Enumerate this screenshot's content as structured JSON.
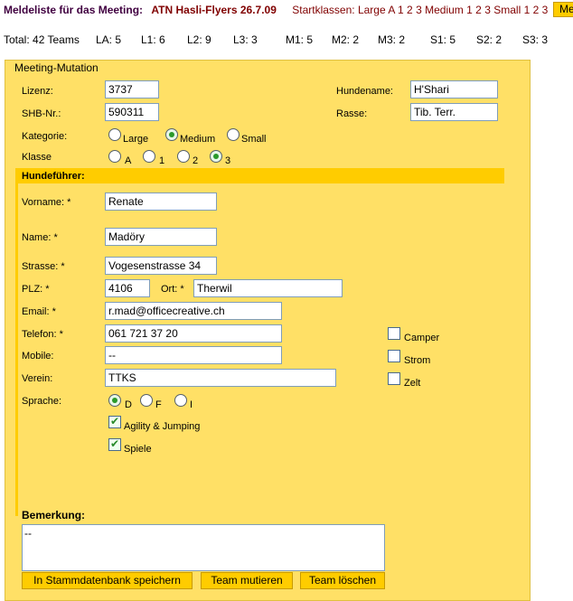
{
  "header": {
    "label": "Meldeliste für das Meeting:",
    "meeting": "ATN Hasli-Flyers 26.7.09",
    "startklassen_label": "Startklassen:",
    "large_label": "Large",
    "large_nums": [
      "A",
      "1",
      "2",
      "3"
    ],
    "medium_label": "Medium",
    "medium_nums": [
      "1",
      "2",
      "3"
    ],
    "small_label": "Small",
    "small_nums": [
      "1",
      "2",
      "3"
    ],
    "side_button": "Me"
  },
  "stats": [
    "Total: 42 Teams",
    "LA: 5",
    "L1: 6",
    "L2: 9",
    "L3: 3",
    "M1: 5",
    "M2: 2",
    "M3: 2",
    "S1: 5",
    "S2: 2",
    "S3: 3"
  ],
  "form": {
    "legend": "Meeting-Mutation",
    "lizenz_label": "Lizenz:",
    "lizenz_value": "3737",
    "shb_label": "SHB-Nr.:",
    "shb_value": "590311",
    "hundename_label": "Hundename:",
    "hundename_value": "H'Shari",
    "rasse_label": "Rasse:",
    "rasse_value": "Tib. Terr.",
    "kategorie_label": "Kategorie:",
    "kategorie_options": [
      "Large",
      "Medium",
      "Small"
    ],
    "kategorie_selected": "Medium",
    "klasse_label": "Klasse",
    "klasse_options": [
      "A",
      "1",
      "2",
      "3"
    ],
    "klasse_selected": "3",
    "section_title": "Hundeführer:",
    "vorname_label": "Vorname: *",
    "vorname_value": "Renate",
    "name_label": "Name: *",
    "name_value": "Madöry",
    "strasse_label": "Strasse: *",
    "strasse_value": "Vogesenstrasse 34",
    "plz_label": "PLZ: *",
    "plz_value": "4106",
    "ort_label": "Ort: *",
    "ort_value": "Therwil",
    "email_label": "Email: *",
    "email_value": "r.mad@officecreative.ch",
    "telefon_label": "Telefon: *",
    "telefon_value": "061 721 37 20",
    "mobile_label": "Mobile:",
    "mobile_value": "--",
    "verein_label": "Verein:",
    "verein_value": "TTKS",
    "sprache_label": "Sprache:",
    "sprache_options": [
      "D",
      "F",
      "I"
    ],
    "sprache_selected": "D",
    "camper_label": "Camper",
    "camper_checked": false,
    "strom_label": "Strom",
    "strom_checked": false,
    "zelt_label": "Zelt",
    "zelt_checked": false,
    "agility_label": "Agility & Jumping",
    "agility_checked": true,
    "spiele_label": "Spiele",
    "spiele_checked": true,
    "bemerkung_label": "Bemerkung:",
    "bemerkung_value": "--"
  },
  "buttons": {
    "save": "In Stammdatenbank speichern",
    "mutate": "Team mutieren",
    "delete": "Team löschen"
  },
  "colors": {
    "panel": "#ffe066",
    "accent": "#ffcc00",
    "header_text": "#800000"
  }
}
